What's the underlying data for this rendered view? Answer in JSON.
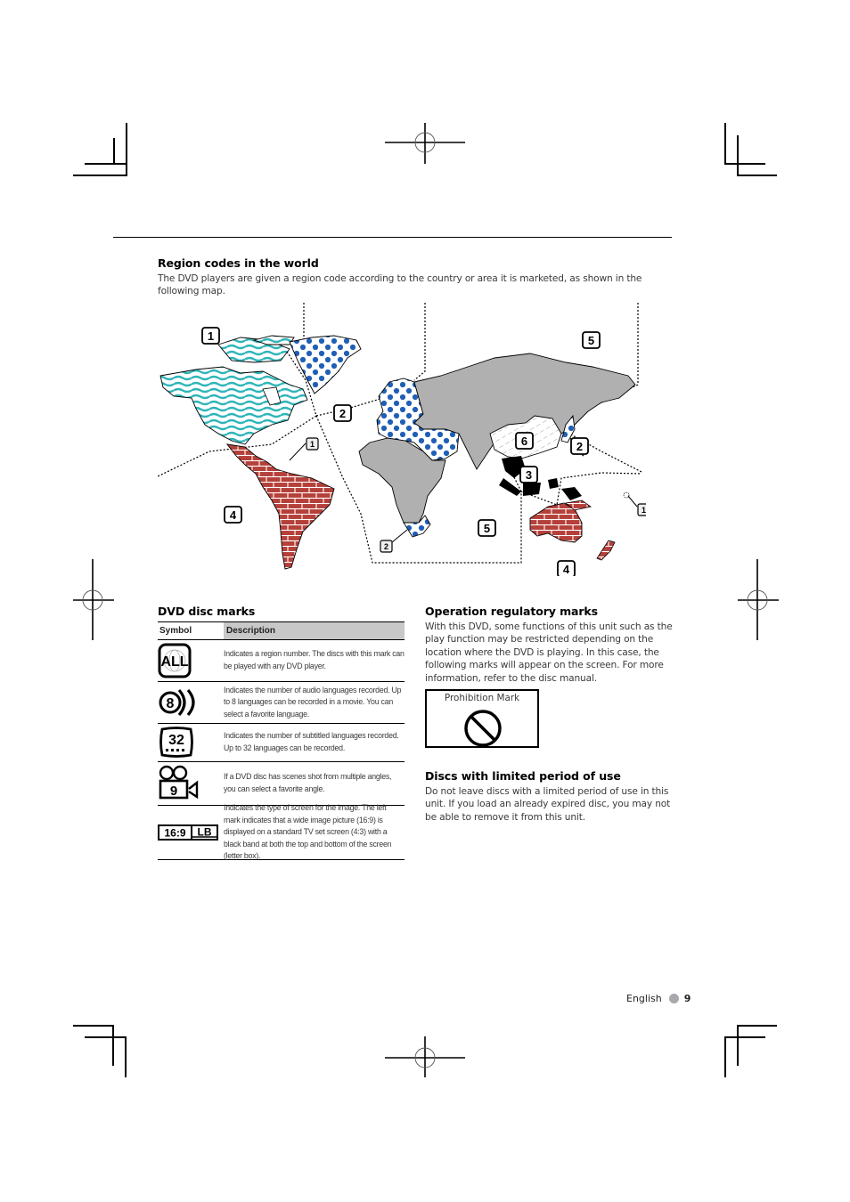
{
  "region_section": {
    "title": "Region codes in the world",
    "intro": "The DVD players are given a region code according to the country or area it is marketed, as shown in the following map."
  },
  "map": {
    "colors": {
      "region1_stripes": "#2fb5b9",
      "region2_dots": "#1f5fb5",
      "region4_bricks": "#b5403a",
      "region5_gray": "#b0b0b0",
      "region3_black": "#000000"
    },
    "labels": [
      {
        "id": "na",
        "text": "1"
      },
      {
        "id": "eu",
        "text": "2"
      },
      {
        "id": "carib",
        "text": "1"
      },
      {
        "id": "sa",
        "text": "4"
      },
      {
        "id": "za",
        "text": "2"
      },
      {
        "id": "af",
        "text": "5"
      },
      {
        "id": "ru",
        "text": "5"
      },
      {
        "id": "cn",
        "text": "6"
      },
      {
        "id": "jp",
        "text": "2"
      },
      {
        "id": "sea",
        "text": "3"
      },
      {
        "id": "au",
        "text": "4"
      },
      {
        "id": "pac",
        "text": "1"
      }
    ]
  },
  "disc_marks": {
    "title": "DVD disc marks",
    "headers": {
      "symbol": "Symbol",
      "description": "Description"
    },
    "rows": [
      {
        "symbol": "ALL",
        "symbol_name": "region-all-icon",
        "description": "Indicates a region number. The discs with this mark can be played with any DVD player."
      },
      {
        "symbol": "8",
        "symbol_name": "audio-languages-icon",
        "description": "Indicates the number of audio languages recorded. Up to 8 languages can be recorded in a movie. You can select a favorite language."
      },
      {
        "symbol": "32",
        "symbol_name": "subtitle-languages-icon",
        "description": "Indicates the number of subtitled languages recorded. Up to 32 languages can be recorded."
      },
      {
        "symbol": "9",
        "symbol_name": "camera-angles-icon",
        "description": "If a DVD disc has scenes shot from multiple angles, you can select a favorite angle."
      },
      {
        "symbol": "16:9|LB",
        "symbol_name": "screen-type-icon",
        "description": "Indicates the type of screen for the image. The left mark indicates that a wide image picture (16:9) is displayed on a standard TV set screen (4:3) with a black band at both the top and bottom of the screen (letter box)."
      }
    ],
    "screen_left": "16:9",
    "screen_right": "LB"
  },
  "operation": {
    "title": "Operation regulatory marks",
    "body": "With this DVD, some functions of this unit such as the play function may be restricted depending on the location where the DVD is playing. In this case, the following marks will appear on the screen. For more information, refer to the disc manual.",
    "prohibition_label": "Prohibition Mark"
  },
  "limited": {
    "title": "Discs with limited period of use",
    "body": "Do not leave discs with a limited period of use in this unit. If you load an already expired disc, you may not be able to remove it from this unit."
  },
  "footer": {
    "language": "English",
    "page": "9"
  }
}
